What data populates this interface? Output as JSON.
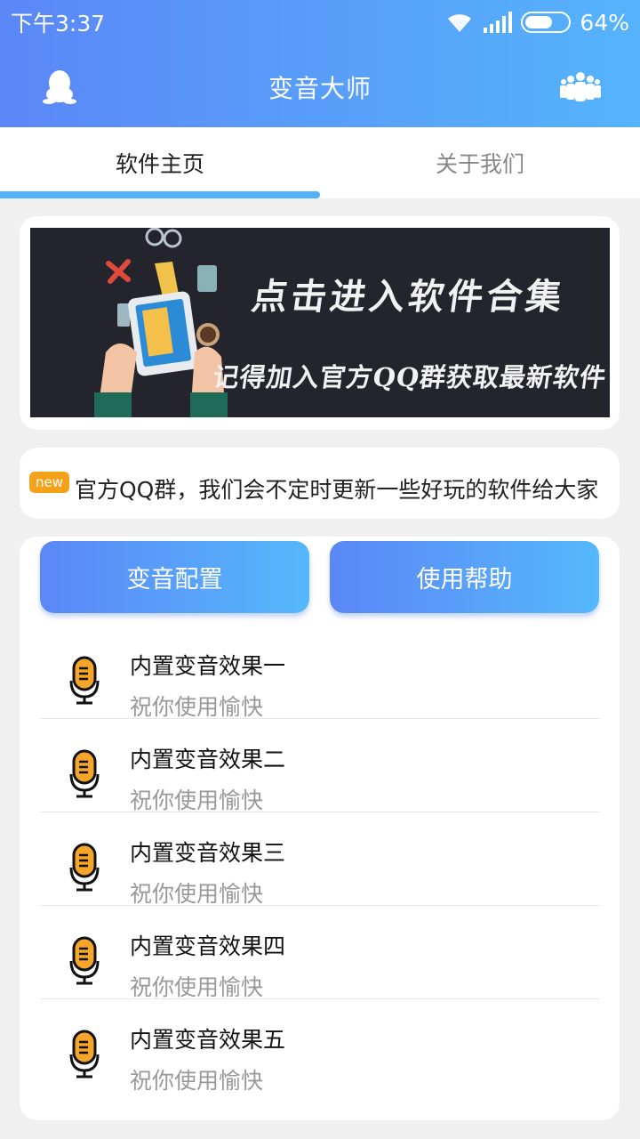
{
  "status_bar": {
    "time": "下午3:37",
    "battery": "64%",
    "battery_level": 0.64
  },
  "app_bar": {
    "title": "变音大师",
    "left_icon": "qq-penguin-icon",
    "right_icon": "group-icon"
  },
  "tabs": [
    {
      "label": "软件主页",
      "active": true
    },
    {
      "label": "关于我们",
      "active": false
    }
  ],
  "banner": {
    "line1": "点击进入软件合集",
    "line2": "记得加入官方QQ群获取最新软件"
  },
  "notice": {
    "badge": "new",
    "text": "官方QQ群，我们会不定时更新一些好玩的软件给大家"
  },
  "actions": {
    "config_label": "变音配置",
    "help_label": "使用帮助"
  },
  "effects": [
    {
      "title": "内置变音效果一",
      "subtitle": "祝你使用愉快"
    },
    {
      "title": "内置变音效果二",
      "subtitle": "祝你使用愉快"
    },
    {
      "title": "内置变音效果三",
      "subtitle": "祝你使用愉快"
    },
    {
      "title": "内置变音效果四",
      "subtitle": "祝你使用愉快"
    },
    {
      "title": "内置变音效果五",
      "subtitle": "祝你使用愉快"
    }
  ],
  "colors": {
    "header_start": "#5b87f7",
    "header_end": "#55b4fb",
    "tab_indicator": "#52b1f8",
    "badge": "#f5a21b",
    "mic": "#f4a52a"
  }
}
